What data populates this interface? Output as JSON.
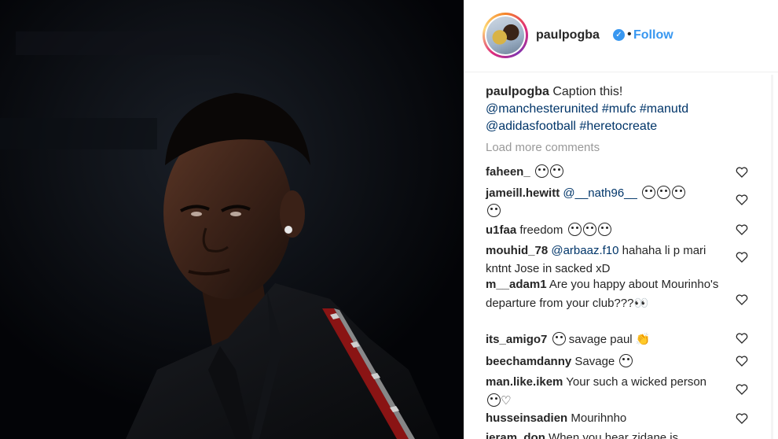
{
  "post": {
    "username": "paulpogba",
    "verified_icon": "verified-badge-icon",
    "separator": "•",
    "follow_label": "Follow",
    "caption_text": "Caption this!",
    "caption_tags_line1": "@manchesterunited #mufc #manutd",
    "caption_tags_line2": "@adidasfootball #heretocreate",
    "load_more": "Load more comments"
  },
  "comments": [
    {
      "user": "faheen_",
      "text": "",
      "emoji_count": 2
    },
    {
      "user": "jameill.hewitt",
      "mention": "@__nath96__",
      "text": "",
      "emoji_count": 4
    },
    {
      "user": "u1faa",
      "text": "freedom",
      "emoji_count": 3
    },
    {
      "user": "mouhid_78",
      "mention": "@arbaaz.f10",
      "text": "hahaha li p mari kntnt Jose in sacked xD",
      "emoji_count": 1
    },
    {
      "user": "m__adam1",
      "text": "Are you happy about Mourinho's departure from your club???",
      "emoji_count": 2
    },
    {
      "user": "its_amigo7",
      "text": "savage paul",
      "emoji_count": 2
    },
    {
      "user": "beechamdanny",
      "text": "Savage",
      "emoji_count": 1
    },
    {
      "user": "man.like.ikem",
      "text": "Your such a wicked person",
      "emoji_count": 2
    },
    {
      "user": "husseinsadien",
      "text": "Mourihnho",
      "emoji_count": 0
    },
    {
      "user": "jeram_don",
      "text": "When you hear zidane is",
      "emoji_count": 0
    }
  ],
  "colors": {
    "link": "#003569",
    "follow": "#3897f0",
    "muted": "#999999",
    "photo_bg": "#04060a"
  }
}
